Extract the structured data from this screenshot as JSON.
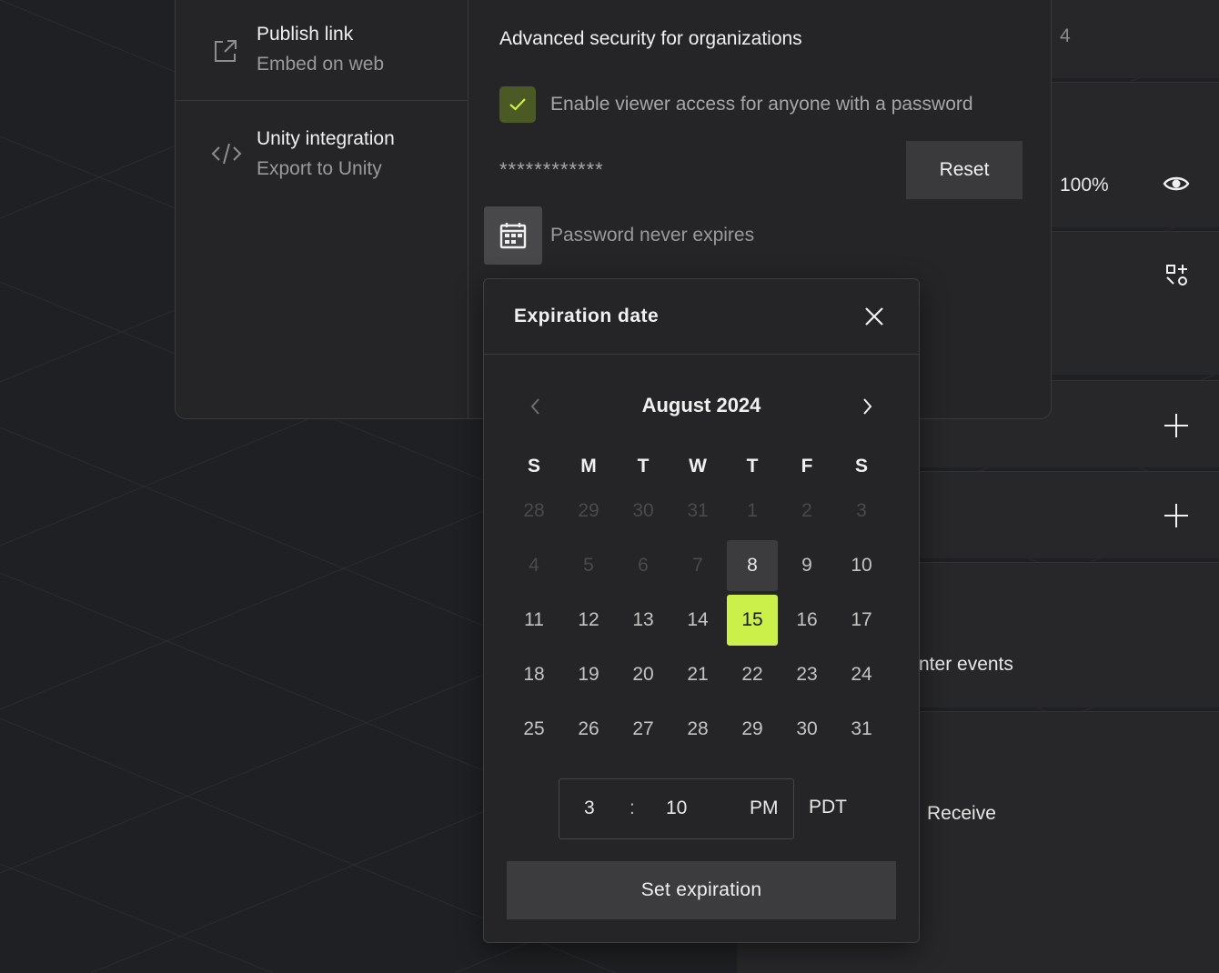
{
  "share_menu": {
    "publish": {
      "title": "Publish link",
      "subtitle": "Embed on web",
      "icon": "external-link-icon"
    },
    "unity": {
      "title": "Unity integration",
      "subtitle": "Export to Unity",
      "icon": "code-icon"
    }
  },
  "security": {
    "title": "Advanced security for organizations",
    "checkbox_label": "Enable viewer access for anyone with a password",
    "checkbox_checked": true,
    "password_mask": "************",
    "reset_label": "Reset",
    "expire_label": "Password never expires"
  },
  "background": {
    "count": "4",
    "zoom": "100%",
    "events_label": "nter events",
    "receive_label": "Receive"
  },
  "calendar": {
    "title": "Expiration date",
    "month_label": "August 2024",
    "weekdays": [
      "S",
      "M",
      "T",
      "W",
      "T",
      "F",
      "S"
    ],
    "weeks": [
      [
        "28",
        "29",
        "30",
        "31",
        "1",
        "2",
        "3"
      ],
      [
        "4",
        "5",
        "6",
        "7",
        "8",
        "9",
        "10"
      ],
      [
        "11",
        "12",
        "13",
        "14",
        "15",
        "16",
        "17"
      ],
      [
        "18",
        "19",
        "20",
        "21",
        "22",
        "23",
        "24"
      ],
      [
        "25",
        "26",
        "27",
        "28",
        "29",
        "30",
        "31"
      ]
    ],
    "today": "8",
    "selected": "15",
    "time": {
      "hour": "3",
      "separator": ":",
      "minute": "10",
      "ampm": "PM",
      "timezone": "PDT"
    },
    "button_label": "Set expiration"
  },
  "colors": {
    "accent": "#ccf04a",
    "checkbox": "#4b5a24",
    "background": "#1f2023",
    "panel": "#252527"
  }
}
